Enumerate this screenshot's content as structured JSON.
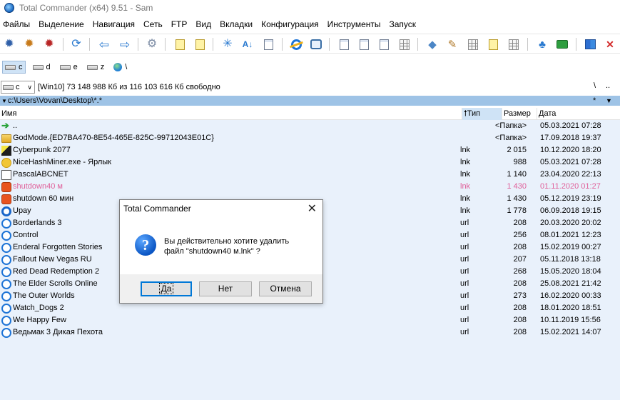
{
  "window": {
    "title": "Total Commander (x64) 9.51 - Sam"
  },
  "menu": [
    "Файлы",
    "Выделение",
    "Навигация",
    "Сеть",
    "FTP",
    "Вид",
    "Вкладки",
    "Конфигурация",
    "Инструменты",
    "Запуск"
  ],
  "drives": [
    {
      "letter": "c",
      "active": true
    },
    {
      "letter": "d",
      "active": false
    },
    {
      "letter": "e",
      "active": false
    },
    {
      "letter": "z",
      "active": false
    }
  ],
  "network_root": "\\",
  "drive_selector": {
    "value": "c"
  },
  "free_space": "[Win10]  73 148 988 Кб из 116 103 616 Кб свободно",
  "nav_buttons": {
    "root": "\\",
    "up": "..",
    "history": "*",
    "menu_arrow": "▼"
  },
  "path": "c:\\Users\\Vovan\\Desktop\\*.*",
  "columns": {
    "name": "Имя",
    "ext": "Тип",
    "size": "Размер",
    "date": "Дата"
  },
  "files": [
    {
      "icon": "up-arrow-icon",
      "name": "..",
      "ext": "",
      "size": "<Папка>",
      "date": "05.03.2021 07:28"
    },
    {
      "icon": "folder-icon",
      "name": "GodMode.{ED7BA470-8E54-465E-825C-99712043E01C}",
      "ext": "",
      "size": "<Папка>",
      "date": "17.09.2018 19:37"
    },
    {
      "icon": "cyberpunk-icon",
      "name": "Cyberpunk 2077",
      "ext": "lnk",
      "size": "2 015",
      "date": "10.12.2020 18:20"
    },
    {
      "icon": "nicehash-icon",
      "name": "NiceHashMiner.exe - Ярлык",
      "ext": "lnk",
      "size": "988",
      "date": "05.03.2021 07:28"
    },
    {
      "icon": "pascal-icon",
      "name": "PascalABCNET",
      "ext": "lnk",
      "size": "1 140",
      "date": "23.04.2020 22:13"
    },
    {
      "icon": "shutdown-icon",
      "name": "shutdown40 м",
      "ext": "lnk",
      "size": "1 430",
      "date": "01.11.2020 01:27",
      "highlight": true
    },
    {
      "icon": "shutdown-icon",
      "name": "shutdown 60 мин",
      "ext": "lnk",
      "size": "1 430",
      "date": "05.12.2019 23:19"
    },
    {
      "icon": "uplay-icon",
      "name": "Upay",
      "ext": "lnk",
      "size": "1 778",
      "date": "06.09.2018 19:15"
    },
    {
      "icon": "internet-shortcut-icon",
      "name": "Borderlands 3",
      "ext": "url",
      "size": "208",
      "date": "20.03.2020 20:02"
    },
    {
      "icon": "internet-shortcut-icon",
      "name": "Control",
      "ext": "url",
      "size": "256",
      "date": "08.01.2021 12:23"
    },
    {
      "icon": "internet-shortcut-icon",
      "name": "Enderal Forgotten Stories",
      "ext": "url",
      "size": "208",
      "date": "15.02.2019 00:27"
    },
    {
      "icon": "internet-shortcut-icon",
      "name": "Fallout New Vegas RU",
      "ext": "url",
      "size": "207",
      "date": "05.11.2018 13:18"
    },
    {
      "icon": "internet-shortcut-icon",
      "name": "Red Dead Redemption 2",
      "ext": "url",
      "size": "268",
      "date": "15.05.2020 18:04"
    },
    {
      "icon": "internet-shortcut-icon",
      "name": "The Elder Scrolls Online",
      "ext": "url",
      "size": "208",
      "date": "25.08.2021 21:42"
    },
    {
      "icon": "internet-shortcut-icon",
      "name": "The Outer Worlds",
      "ext": "url",
      "size": "273",
      "date": "16.02.2020 00:33"
    },
    {
      "icon": "internet-shortcut-icon",
      "name": "Watch_Dogs 2",
      "ext": "url",
      "size": "208",
      "date": "18.01.2020 18:51"
    },
    {
      "icon": "internet-shortcut-icon",
      "name": "We Happy Few",
      "ext": "url",
      "size": "208",
      "date": "10.11.2019 15:56"
    },
    {
      "icon": "internet-shortcut-icon",
      "name": "Ведьмак 3 Дикая Пехота",
      "ext": "url",
      "size": "208",
      "date": "15.02.2021 14:07"
    }
  ],
  "dialog": {
    "title": "Total Commander",
    "message_line1": "Вы действительно хотите удалить",
    "message_line2": "файл \"shutdown40 м.lnk\" ?",
    "btn_yes": "Да",
    "btn_no": "Нет",
    "btn_cancel": "Отмена"
  },
  "colors": {
    "list_bg": "#e9f1fb",
    "path_bar": "#9ec3e6",
    "highlight_text": "#e0609a",
    "default_button_border": "#0078d7"
  }
}
